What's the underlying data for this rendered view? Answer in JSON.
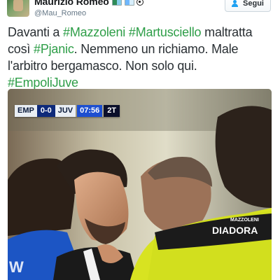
{
  "user": {
    "display_name": "Maurizio Romeo",
    "handle": "@Mau_Romeo",
    "icons": [
      "flag-icon",
      "flag-icon",
      "soccer-ball-icon"
    ]
  },
  "follow_button": {
    "label": "Segui",
    "icon": "follow-person-icon"
  },
  "tweet": {
    "segments": {
      "s1": "Davanti a ",
      "h1": "#Mazzoleni",
      "h2": "#Martusciello",
      "s2": " maltratta",
      "s3": "così ",
      "h3": "#Pjanic",
      "s4": ". Nemmeno un richiamo. Male",
      "s5": "l'arbitro bergamasco. Non solo qui.",
      "h4": "#EmpoliJuve"
    }
  },
  "photo": {
    "scorebug": {
      "home": "EMP",
      "score": "0-0",
      "away": "JUV",
      "clock": "07:56",
      "half": "2T"
    },
    "jersey_text": {
      "brand": "DIADORA",
      "brand_small": "MAZZOLENI"
    }
  },
  "colors": {
    "hashtag": "#2e9e48",
    "referee_jersey": "#d8e321",
    "empoli_blue": "#1c55c4"
  }
}
